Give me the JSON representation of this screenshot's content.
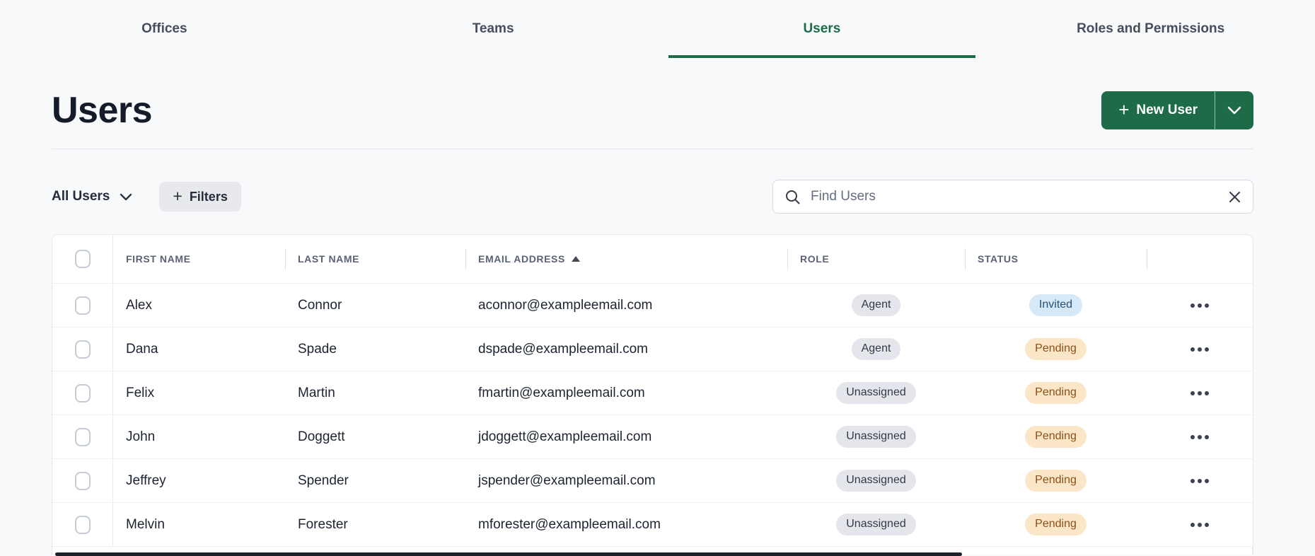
{
  "colors": {
    "accent_green": "#1d6b47",
    "page_bg": "#f8f9fb"
  },
  "tabs": {
    "items": [
      {
        "label": "Offices",
        "active": false
      },
      {
        "label": "Teams",
        "active": false
      },
      {
        "label": "Users",
        "active": true
      },
      {
        "label": "Roles and Permissions",
        "active": false
      }
    ]
  },
  "header": {
    "title": "Users",
    "new_user_button": {
      "plus": "+",
      "label": "New User"
    }
  },
  "toolbar": {
    "view_selector": {
      "label": "All Users"
    },
    "filters_button": {
      "plus": "+",
      "label": "Filters"
    },
    "search": {
      "placeholder": "Find Users",
      "value": ""
    }
  },
  "table": {
    "columns": [
      {
        "label": "FIRST NAME"
      },
      {
        "label": "LAST NAME"
      },
      {
        "label": "EMAIL ADDRESS",
        "sorted": "asc"
      },
      {
        "label": "ROLE"
      },
      {
        "label": "STATUS"
      }
    ],
    "rows": [
      {
        "first_name": "Alex",
        "last_name": "Connor",
        "email": "aconnor@exampleemail.com",
        "role": "Agent",
        "status": "Invited"
      },
      {
        "first_name": "Dana",
        "last_name": "Spade",
        "email": "dspade@exampleemail.com",
        "role": "Agent",
        "status": "Pending"
      },
      {
        "first_name": "Felix",
        "last_name": "Martin",
        "email": "fmartin@exampleemail.com",
        "role": "Unassigned",
        "status": "Pending"
      },
      {
        "first_name": "John",
        "last_name": "Doggett",
        "email": "jdoggett@exampleemail.com",
        "role": "Unassigned",
        "status": "Pending"
      },
      {
        "first_name": "Jeffrey",
        "last_name": "Spender",
        "email": "jspender@exampleemail.com",
        "role": "Unassigned",
        "status": "Pending"
      },
      {
        "first_name": "Melvin",
        "last_name": "Forester",
        "email": "mforester@exampleemail.com",
        "role": "Unassigned",
        "status": "Pending"
      }
    ],
    "badge_colors": {
      "Agent": {
        "bg": "#e4e6eb",
        "fg": "#313a47"
      },
      "Unassigned": {
        "bg": "#e4e6eb",
        "fg": "#313a47"
      },
      "Invited": {
        "bg": "#d6e9f8",
        "fg": "#27506f"
      },
      "Pending": {
        "bg": "#fbe6c8",
        "fg": "#8c4f17"
      }
    }
  }
}
